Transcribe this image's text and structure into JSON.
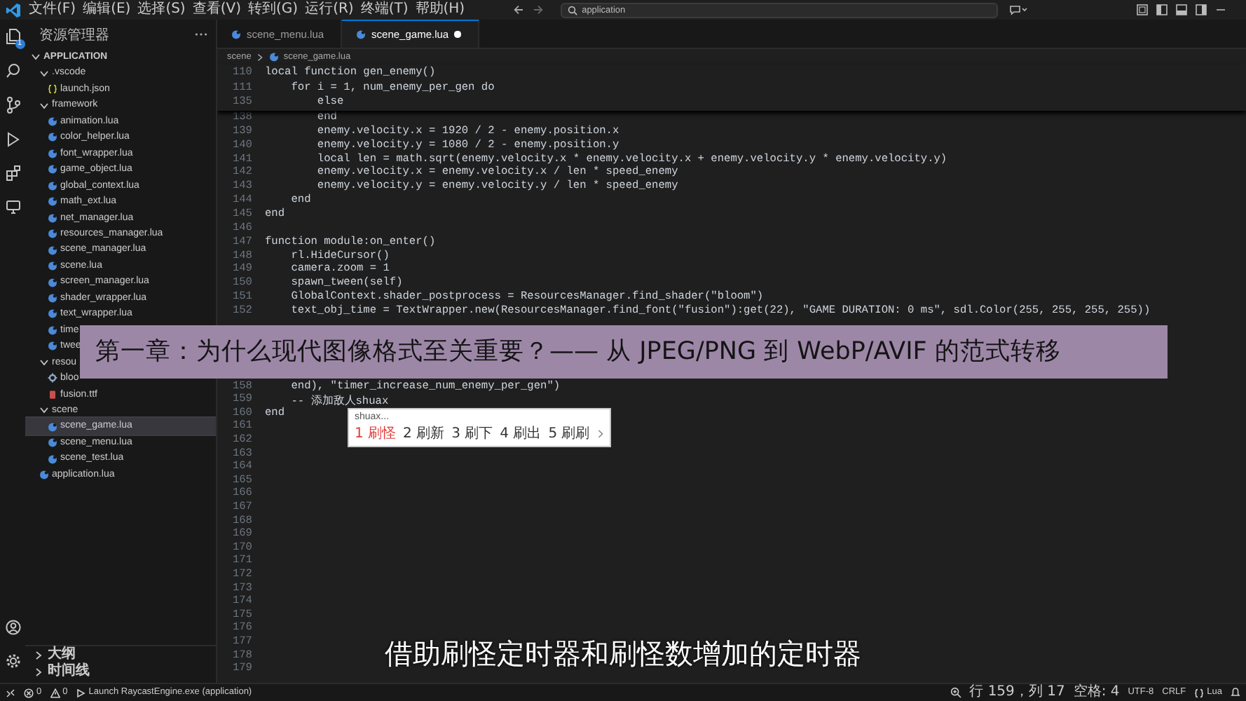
{
  "menu": [
    "文件(F)",
    "编辑(E)",
    "选择(S)",
    "查看(V)",
    "转到(G)",
    "运行(R)",
    "终端(T)",
    "帮助(H)"
  ],
  "search": {
    "value": "application"
  },
  "activity_bar": {
    "badge": "1"
  },
  "explorer": {
    "title": "资源管理器",
    "tree": [
      {
        "label": "APPLICATION",
        "kind": "root",
        "expanded": true,
        "selected": false,
        "children": [
          {
            "label": ".vscode",
            "kind": "folder",
            "expanded": true,
            "selected": false,
            "children": [
              {
                "label": "launch.json",
                "kind": "json",
                "selected": false
              }
            ]
          },
          {
            "label": "framework",
            "kind": "folder",
            "expanded": true,
            "selected": false,
            "children": [
              {
                "label": "animation.lua",
                "kind": "lua",
                "selected": false
              },
              {
                "label": "color_helper.lua",
                "kind": "lua",
                "selected": false
              },
              {
                "label": "font_wrapper.lua",
                "kind": "lua",
                "selected": false
              },
              {
                "label": "game_object.lua",
                "kind": "lua",
                "selected": false
              },
              {
                "label": "global_context.lua",
                "kind": "lua",
                "selected": false
              },
              {
                "label": "math_ext.lua",
                "kind": "lua",
                "selected": false
              },
              {
                "label": "net_manager.lua",
                "kind": "lua",
                "selected": false
              },
              {
                "label": "resources_manager.lua",
                "kind": "lua",
                "selected": false
              },
              {
                "label": "scene_manager.lua",
                "kind": "lua",
                "selected": false
              },
              {
                "label": "scene.lua",
                "kind": "lua",
                "selected": false
              },
              {
                "label": "screen_manager.lua",
                "kind": "lua",
                "selected": false
              },
              {
                "label": "shader_wrapper.lua",
                "kind": "lua",
                "selected": false
              },
              {
                "label": "text_wrapper.lua",
                "kind": "lua",
                "selected": false
              },
              {
                "label": "time",
                "kind": "lua",
                "selected": false
              },
              {
                "label": "twee",
                "kind": "lua",
                "selected": false
              }
            ]
          },
          {
            "label": "resou",
            "kind": "folder",
            "expanded": true,
            "selected": false,
            "children": [
              {
                "label": "bloo",
                "kind": "shader",
                "selected": false
              },
              {
                "label": "fusion.ttf",
                "kind": "font",
                "selected": false
              }
            ]
          },
          {
            "label": "scene",
            "kind": "folder",
            "expanded": true,
            "selected": false,
            "children": [
              {
                "label": "scene_game.lua",
                "kind": "lua",
                "selected": true
              },
              {
                "label": "scene_menu.lua",
                "kind": "lua",
                "selected": false
              },
              {
                "label": "scene_test.lua",
                "kind": "lua",
                "selected": false
              }
            ]
          },
          {
            "label": "application.lua",
            "kind": "lua",
            "selected": false
          }
        ]
      }
    ],
    "sections": [
      {
        "label": "大纲",
        "expanded": false
      },
      {
        "label": "时间线",
        "expanded": false
      }
    ]
  },
  "tabs": [
    {
      "label": "scene_menu.lua",
      "selected": false,
      "modified": false
    },
    {
      "label": "scene_game.lua",
      "selected": true,
      "modified": true
    }
  ],
  "breadcrumb": [
    "scene",
    "scene_game.lua"
  ],
  "sticky_lines": [
    {
      "line": "110",
      "code": "local function gen_enemy()"
    },
    {
      "line": "111",
      "code": "    for i = 1, num_enemy_per_gen do"
    },
    {
      "line": "135",
      "code": "        else"
    }
  ],
  "code_top": [
    {
      "line": "138",
      "code": "        end"
    },
    {
      "line": "139",
      "code": "        enemy.velocity.x = 1920 / 2 - enemy.position.x"
    },
    {
      "line": "140",
      "code": "        enemy.velocity.y = 1080 / 2 - enemy.position.y"
    },
    {
      "line": "141",
      "code": "        local len = math.sqrt(enemy.velocity.x * enemy.velocity.x + enemy.velocity.y * enemy.velocity.y)"
    },
    {
      "line": "142",
      "code": "        enemy.velocity.x = enemy.velocity.x / len * speed_enemy"
    },
    {
      "line": "143",
      "code": "        enemy.velocity.y = enemy.velocity.y / len * speed_enemy"
    },
    {
      "line": "144",
      "code": "    end"
    },
    {
      "line": "145",
      "code": "end"
    },
    {
      "line": "146"
    },
    {
      "line": "147",
      "code": "function module:on_enter()"
    },
    {
      "line": "148",
      "code": "    rl.HideCursor()"
    },
    {
      "line": "149",
      "code": "    camera.zoom = 1"
    },
    {
      "line": "150",
      "code": "    spawn_tween(self)"
    },
    {
      "line": "151",
      "code": "    GlobalContext.shader_postprocess = ResourcesManager.find_shader(\"bloom\")"
    },
    {
      "line": "152",
      "code": "    text_obj_time = TextWrapper.new(ResourcesManager.find_font(\"fusion\"):get(22), \"GAME DURATION: 0 ms\", sdl.Color(255, 255, 255, 255))"
    }
  ],
  "code_bottom": [
    {
      "line": "158",
      "code": "    end), \"timer_increase_num_enemy_per_gen\")"
    },
    {
      "line": "159",
      "code": "    -- 添加敌人shuax"
    },
    {
      "line": "160",
      "code": "end"
    },
    {
      "line": "161"
    },
    {
      "line": "162"
    },
    {
      "line": "163"
    },
    {
      "line": "164"
    },
    {
      "line": "165"
    },
    {
      "line": "166"
    },
    {
      "line": "167"
    },
    {
      "line": "168"
    },
    {
      "line": "169"
    },
    {
      "line": "170"
    },
    {
      "line": "171"
    },
    {
      "line": "172"
    },
    {
      "line": "173"
    },
    {
      "line": "174"
    },
    {
      "line": "175"
    },
    {
      "line": "176"
    },
    {
      "line": "177"
    },
    {
      "line": "178"
    },
    {
      "line": "179"
    }
  ],
  "suggest": {
    "query": "shuax...",
    "candidates": [
      {
        "index": "1",
        "text": "刷怪",
        "selected": true
      },
      {
        "index": "2",
        "text": "刷新",
        "selected": false
      },
      {
        "index": "3",
        "text": "刷下",
        "selected": false
      },
      {
        "index": "4",
        "text": "刷出",
        "selected": false
      },
      {
        "index": "5",
        "text": "刷刷",
        "selected": false
      }
    ]
  },
  "banner": "第一章：为什么现代图像格式至关重要？—— 从 JPEG/PNG 到 WebP/AVIF 的范式转移",
  "subtitle": "借助刷怪定时器和刷怪数增加的定时器",
  "status_bar": {
    "errors": "0",
    "warnings": "0",
    "launch": "Launch RaycastEngine.exe (application)",
    "position": "行 159，列 17",
    "indent": "空格: 4",
    "encoding": "UTF-8",
    "eol": "CRLF",
    "language": "Lua"
  }
}
